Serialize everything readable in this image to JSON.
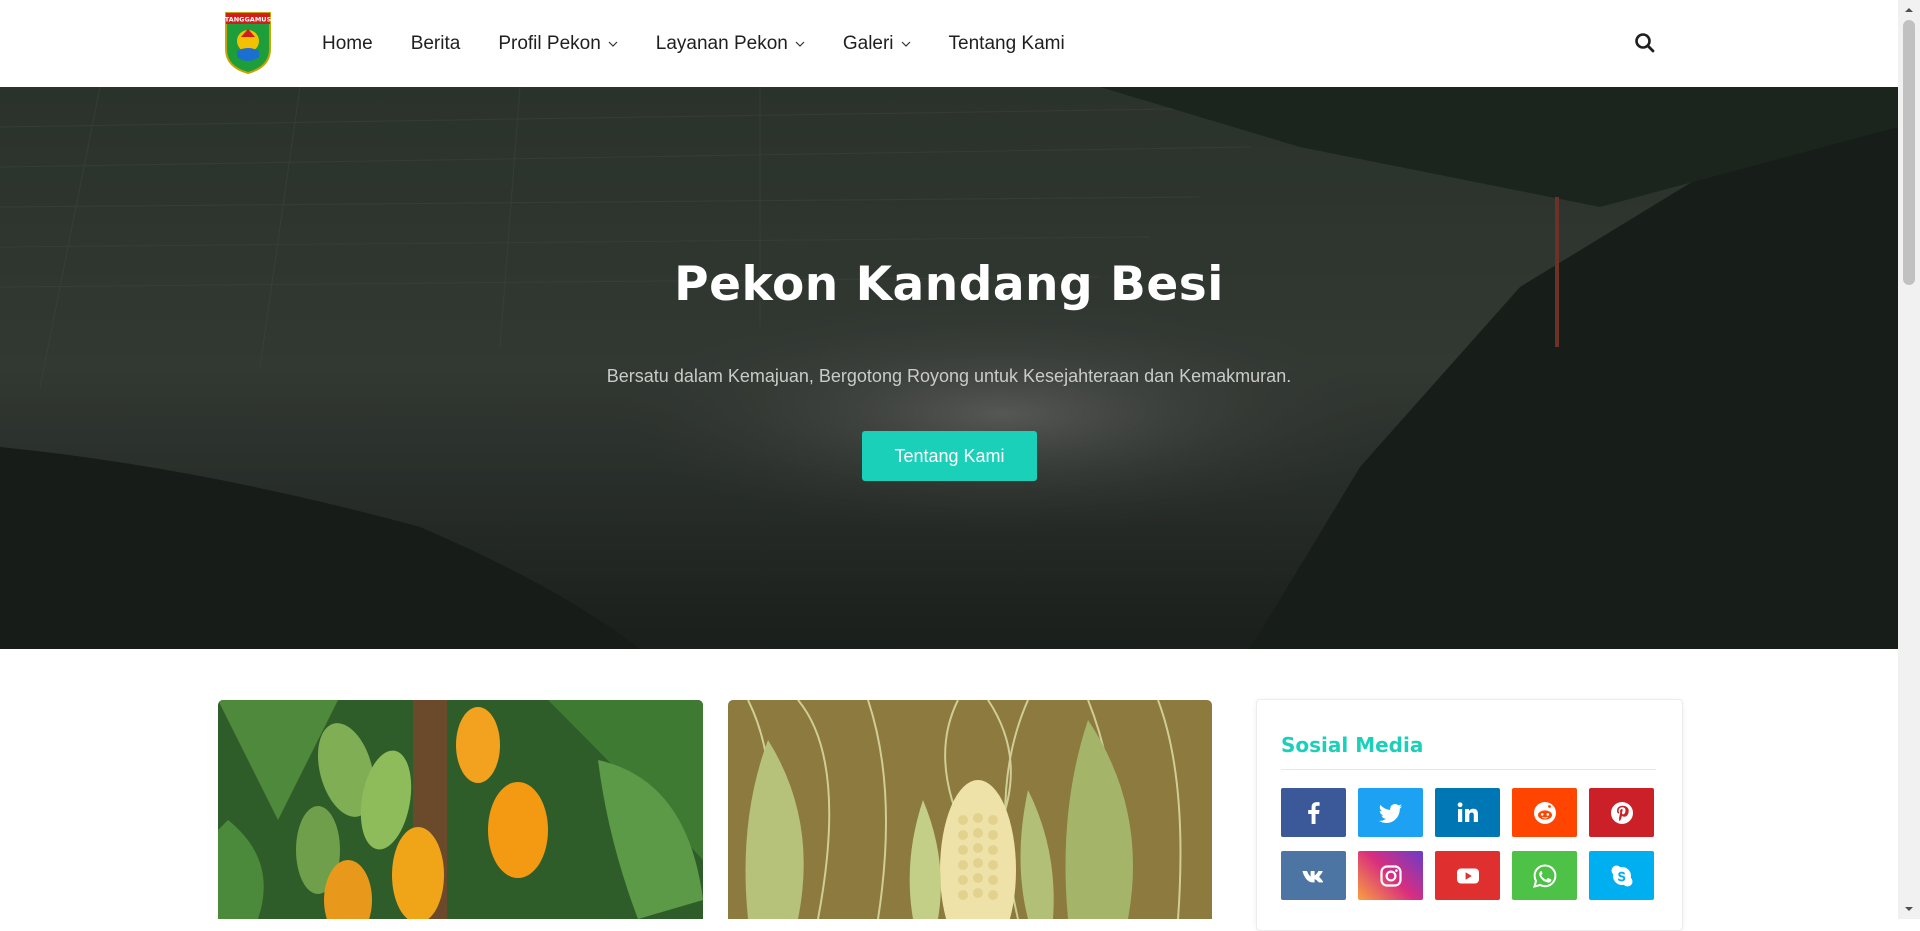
{
  "header": {
    "logo_text": "TANGGAMUS",
    "nav": [
      {
        "label": "Home",
        "has_dropdown": false
      },
      {
        "label": "Berita",
        "has_dropdown": false
      },
      {
        "label": "Profil Pekon",
        "has_dropdown": true
      },
      {
        "label": "Layanan Pekon",
        "has_dropdown": true
      },
      {
        "label": "Galeri",
        "has_dropdown": true
      },
      {
        "label": "Tentang Kami",
        "has_dropdown": false
      }
    ],
    "search_icon": "search-icon"
  },
  "hero": {
    "title": "Pekon Kandang Besi",
    "subtitle": "Bersatu dalam Kemajuan, Bergotong Royong untuk Kesejahteraan dan Kemakmuran.",
    "button_label": "Tentang Kami",
    "accent_color": "#1bd0b9"
  },
  "cards": [
    {
      "image": "cacao-pods-image"
    },
    {
      "image": "corn-cobs-image"
    }
  ],
  "sidebar": {
    "title": "Sosial Media",
    "social": [
      {
        "name": "facebook",
        "color": "#3b5998"
      },
      {
        "name": "twitter",
        "color": "#1da1f2"
      },
      {
        "name": "linkedin",
        "color": "#0077b5"
      },
      {
        "name": "reddit",
        "color": "#ff4500"
      },
      {
        "name": "pinterest",
        "color": "#cb2027"
      },
      {
        "name": "vk",
        "color": "#4c75a3"
      },
      {
        "name": "instagram",
        "color": "#c13584"
      },
      {
        "name": "youtube",
        "color": "#e62117"
      },
      {
        "name": "whatsapp",
        "color": "#4dc247"
      },
      {
        "name": "skype",
        "color": "#00aff0"
      }
    ]
  }
}
